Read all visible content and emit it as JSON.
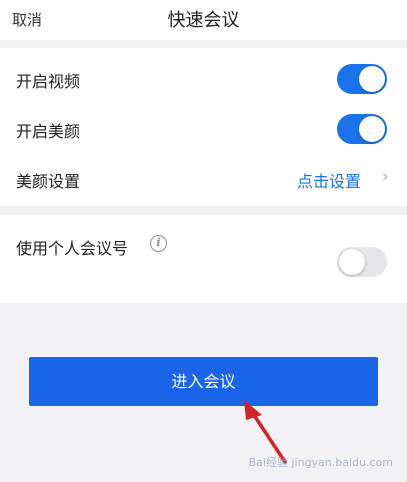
{
  "header": {
    "cancel_label": "取消",
    "title": "快速会议"
  },
  "settings": {
    "video": {
      "label": "开启视频",
      "enabled": true
    },
    "beauty": {
      "label": "开启美颜",
      "enabled": true
    },
    "beauty_settings": {
      "label": "美颜设置",
      "action_label": "点击设置"
    },
    "personal_id": {
      "label": "使用个人会议号",
      "enabled": false
    }
  },
  "join_button_label": "进入会议",
  "watermark": "Bai经验 jingyan.baidu.com",
  "colors": {
    "accent": "#1a73e8",
    "button": "#1a64e8",
    "arrow": "#d0232b"
  }
}
